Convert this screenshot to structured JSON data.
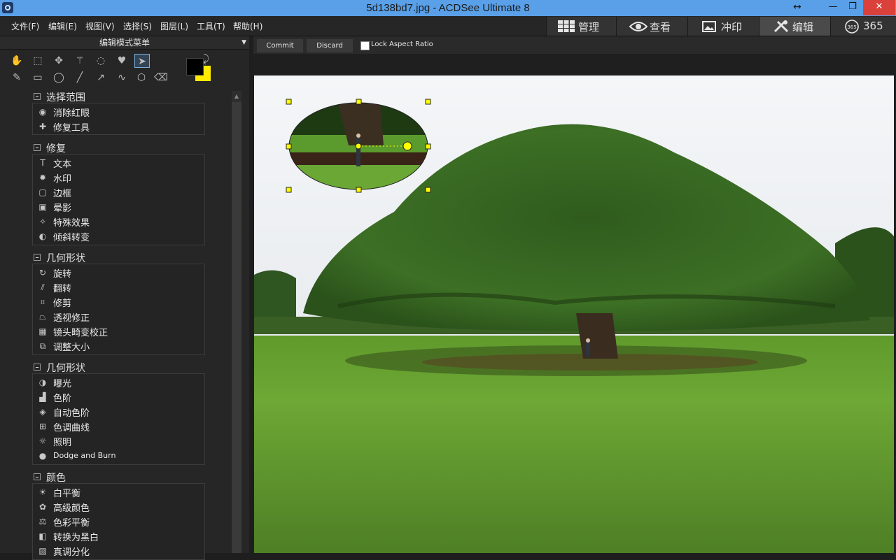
{
  "window": {
    "title": "5d138bd7.jpg - ACDSee Ultimate 8",
    "resize_glyph": "↔",
    "minimize": "—",
    "maximize": "❐",
    "close": "✕"
  },
  "menu": [
    "文件(F)",
    "编辑(E)",
    "视图(V)",
    "选择(S)",
    "图层(L)",
    "工具(T)",
    "帮助(H)"
  ],
  "modes": [
    {
      "label": "管理",
      "icon": "grid-icon"
    },
    {
      "label": "查看",
      "icon": "eye-icon"
    },
    {
      "label": "冲印",
      "icon": "photo-icon"
    },
    {
      "label": "编辑",
      "icon": "tools-icon",
      "active": true
    },
    {
      "label": "365",
      "icon": "365-icon"
    }
  ],
  "panel": {
    "title": "编辑模式菜单",
    "sections": [
      {
        "title": "选择范围",
        "items": [
          {
            "label": "消除红眼",
            "icon": "eye-icon"
          },
          {
            "label": "修复工具",
            "icon": "bandage-icon"
          }
        ]
      },
      {
        "title": "修复",
        "items": [
          {
            "label": "文本",
            "icon": "text-icon"
          },
          {
            "label": "水印",
            "icon": "watermark-icon"
          },
          {
            "label": "边框",
            "icon": "border-icon"
          },
          {
            "label": "晕影",
            "icon": "vignette-icon"
          },
          {
            "label": "特殊效果",
            "icon": "wand-icon"
          },
          {
            "label": "倾斜转变",
            "icon": "tilt-shift-icon"
          }
        ]
      },
      {
        "title": "几何形状",
        "items": [
          {
            "label": "旋转",
            "icon": "rotate-icon"
          },
          {
            "label": "翻转",
            "icon": "flip-icon"
          },
          {
            "label": "修剪",
            "icon": "crop-icon"
          },
          {
            "label": "透视修正",
            "icon": "perspective-icon"
          },
          {
            "label": "镜头畸变校正",
            "icon": "lens-icon"
          },
          {
            "label": "调整大小",
            "icon": "resize-icon"
          }
        ]
      },
      {
        "title": "几何形状",
        "items": [
          {
            "label": "曝光",
            "icon": "exposure-icon"
          },
          {
            "label": "色阶",
            "icon": "levels-icon"
          },
          {
            "label": "自动色阶",
            "icon": "auto-levels-icon"
          },
          {
            "label": "色调曲线",
            "icon": "curves-icon"
          },
          {
            "label": "照明",
            "icon": "lighting-icon"
          },
          {
            "label": "Dodge and Burn",
            "icon": "dodge-burn-icon"
          }
        ]
      },
      {
        "title": "颜色",
        "items": [
          {
            "label": "白平衡",
            "icon": "white-balance-icon"
          },
          {
            "label": "高级颜色",
            "icon": "palette-icon"
          },
          {
            "label": "色彩平衡",
            "icon": "scale-icon"
          },
          {
            "label": "转换为黑白",
            "icon": "bw-icon"
          },
          {
            "label": "真调分化",
            "icon": "split-tone-icon"
          }
        ]
      }
    ]
  },
  "options": {
    "commit": "Commit",
    "discard": "Discard",
    "lock_aspect": "Lock Aspect Ratio",
    "lock_aspect_checked": false
  },
  "colors": {
    "foreground": "#000000",
    "background": "#ffea00",
    "accent": "#5aa0e8"
  }
}
